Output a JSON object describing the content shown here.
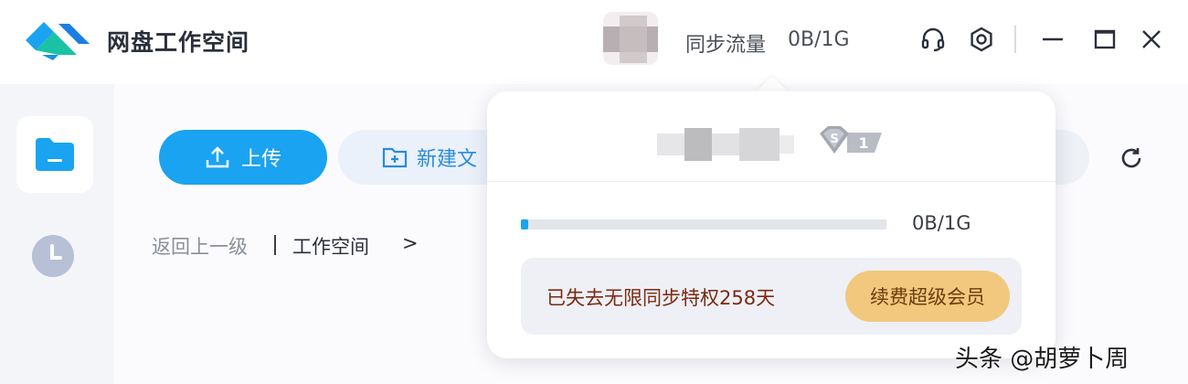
{
  "app": {
    "title": "网盘工作空间"
  },
  "header": {
    "sync_label": "同步流量",
    "sync_value": "0B/1G",
    "icons": [
      "headset-icon",
      "settings-icon",
      "minimize-icon",
      "maximize-icon",
      "close-icon"
    ]
  },
  "sidebar": {
    "items": [
      {
        "name": "files",
        "icon": "folder-icon",
        "active": true
      },
      {
        "name": "recent",
        "icon": "clock-icon",
        "active": false
      }
    ]
  },
  "toolbar": {
    "upload_label": "上传",
    "new_folder_label": "新建文"
  },
  "breadcrumb": {
    "back_label": "返回上一级",
    "current": "工作空间",
    "arrow": ">"
  },
  "popover": {
    "badge_letter": "S",
    "badge_level": "1",
    "usage_value": "0B/1G",
    "usage_fraction": 0.02,
    "notice_text": "已失去无限同步特权258天",
    "renew_label": "续费超级会员"
  },
  "watermark": "头条 @胡萝卜周",
  "colors": {
    "accent": "#1aa3f0",
    "renew_bg": "#f1c87d",
    "notice_text": "#7a2a12"
  }
}
